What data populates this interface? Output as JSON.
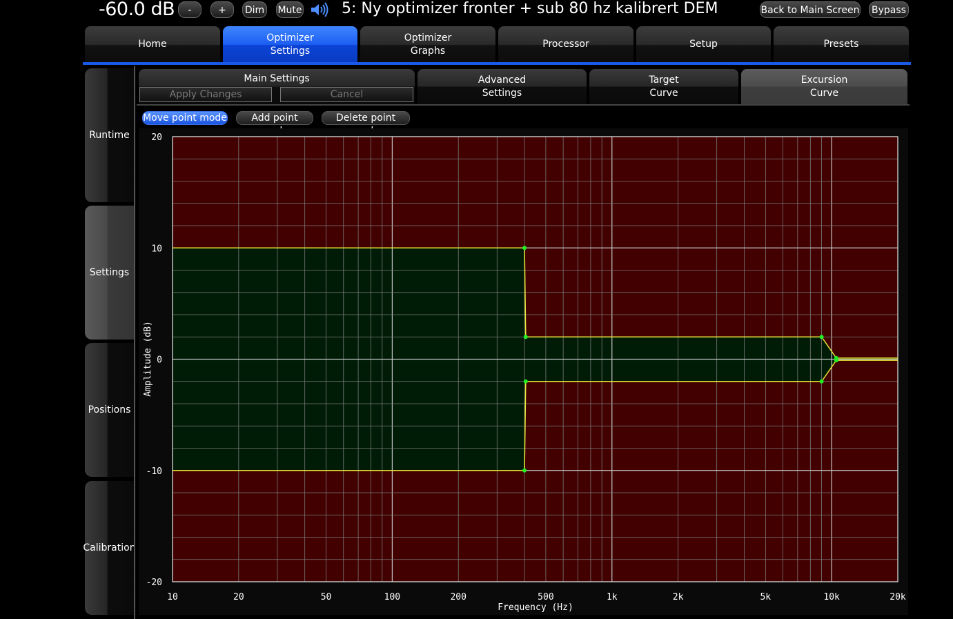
{
  "topbar": {
    "volume": "-60.0 dB",
    "minus_label": "-",
    "plus_label": "+",
    "dim_label": "Dim",
    "mute_label": "Mute",
    "preset_title": "5: Ny optimizer fronter + sub 80 hz kalibrert DEM",
    "back_label": "Back to Main Screen",
    "bypass_label": "Bypass"
  },
  "main_tabs": [
    "Home",
    "Optimizer\nSettings",
    "Optimizer\nGraphs",
    "Processor",
    "Setup",
    "Presets"
  ],
  "active_main_tab": 1,
  "side_tabs": [
    "Runtime",
    "Settings",
    "Positions",
    "Calibration"
  ],
  "active_side_tab": 1,
  "sub_tabs": {
    "main_settings": "Main Settings",
    "apply": "Apply Changes",
    "cancel": "Cancel",
    "advanced": "Advanced\nSettings",
    "target": "Target\nCurve",
    "excursion": "Excursion\nCurve"
  },
  "active_sub_tab": "excursion",
  "modes": [
    "Move point mode",
    "Add point mode",
    "Delete point mode"
  ],
  "active_mode": 0,
  "colors": {
    "accent": "#1a58e8",
    "plot_outside": "#420000",
    "plot_inside": "#001c06",
    "curve": "#e8e838",
    "point": "#22ee22",
    "grid": "#7a7a7a"
  },
  "chart_data": {
    "type": "line",
    "xlabel": "Frequency (Hz)",
    "ylabel": "Amplitude (dB)",
    "xscale": "log",
    "xlim": [
      10,
      20000
    ],
    "ylim": [
      -20,
      20
    ],
    "x_ticks": [
      10,
      20,
      50,
      100,
      200,
      500,
      1000,
      2000,
      5000,
      10000,
      20000
    ],
    "x_tick_labels": [
      "10",
      "20",
      "50",
      "100",
      "200",
      "500",
      "1k",
      "2k",
      "5k",
      "10k",
      "20k"
    ],
    "y_ticks": [
      20,
      10,
      0,
      -10,
      -20
    ],
    "y_tick_labels": [
      "20",
      "10",
      "0",
      "-10",
      "-20"
    ],
    "grid": true,
    "series": [
      {
        "x": [
          10,
          400,
          405,
          9000,
          10500,
          20000
        ],
        "values": [
          10,
          10,
          2,
          2,
          0.1,
          0.1
        ],
        "points": [
          [
            400,
            10
          ],
          [
            405,
            2
          ],
          [
            9000,
            2
          ],
          [
            10500,
            0.1
          ]
        ]
      },
      {
        "x": [
          10,
          400,
          405,
          9000,
          10500,
          20000
        ],
        "values": [
          -10,
          -10,
          -2,
          -2,
          -0.1,
          -0.1
        ],
        "points": [
          [
            400,
            -10
          ],
          [
            405,
            -2
          ],
          [
            9000,
            -2
          ],
          [
            10500,
            -0.1
          ]
        ]
      }
    ]
  }
}
